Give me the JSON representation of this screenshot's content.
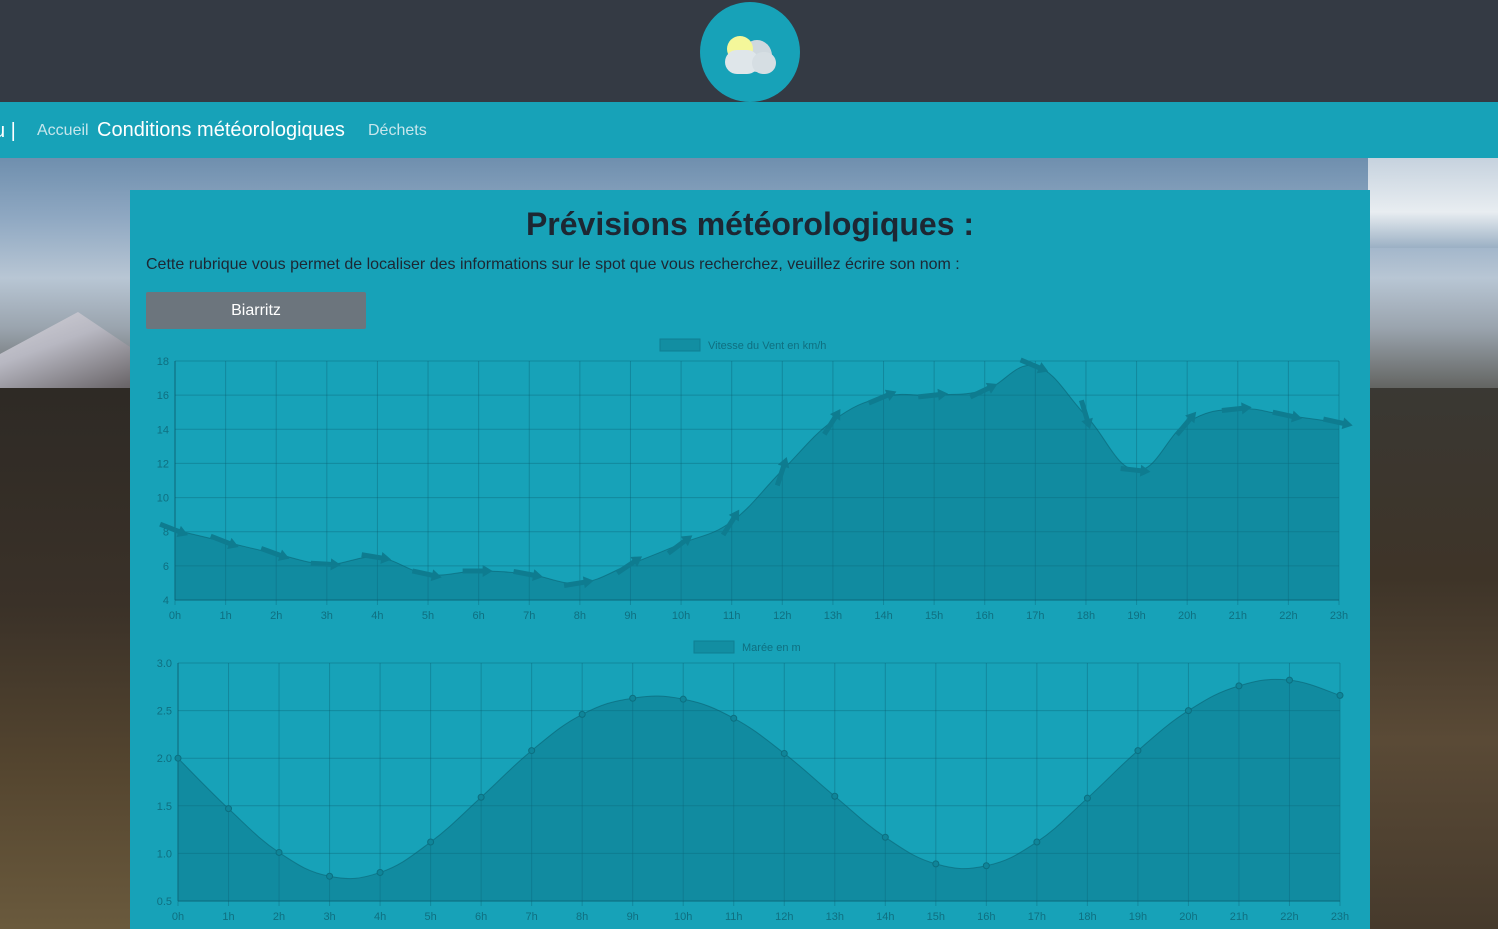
{
  "header": {
    "logo_icon": "sun-cloud-icon"
  },
  "nav": {
    "brand": "u |",
    "items": [
      {
        "label": "Accueil",
        "active": false
      },
      {
        "label": "Conditions météorologiques",
        "active": true
      },
      {
        "label": "Déchets",
        "active": false
      }
    ]
  },
  "main": {
    "title": "Prévisions météorologiques :",
    "description": "Cette rubrique vous permet de localiser des informations sur le spot que vous recherchez, veuillez écrire son nom :",
    "spot_button": "Biarritz"
  },
  "colors": {
    "accent": "#17a2b8",
    "header_bg": "#343a44",
    "button_bg": "#6c757d"
  },
  "chart_data": [
    {
      "type": "area",
      "legend": "Vitesse du Vent en km/h",
      "legend_position": "top",
      "x": [
        "0h",
        "1h",
        "2h",
        "3h",
        "4h",
        "5h",
        "6h",
        "7h",
        "8h",
        "9h",
        "10h",
        "11h",
        "12h",
        "13h",
        "14h",
        "15h",
        "16h",
        "17h",
        "18h",
        "19h",
        "20h",
        "21h",
        "22h",
        "23h"
      ],
      "values": [
        8.1,
        7.4,
        6.7,
        6.1,
        6.5,
        5.5,
        5.7,
        5.5,
        5.0,
        6.1,
        7.3,
        8.6,
        11.6,
        14.5,
        15.9,
        16.0,
        16.3,
        17.7,
        14.8,
        11.6,
        14.4,
        15.2,
        14.8,
        14.4
      ],
      "yticks": [
        4,
        6,
        8,
        10,
        12,
        14,
        16,
        18
      ],
      "ylim": [
        4,
        18
      ],
      "grid": true,
      "point_style": "arrow"
    },
    {
      "type": "area",
      "legend": "Marée en m",
      "legend_position": "top",
      "x": [
        "0h",
        "1h",
        "2h",
        "3h",
        "4h",
        "5h",
        "6h",
        "7h",
        "8h",
        "9h",
        "10h",
        "11h",
        "12h",
        "13h",
        "14h",
        "15h",
        "16h",
        "17h",
        "18h",
        "19h",
        "20h",
        "21h",
        "22h",
        "23h"
      ],
      "values": [
        2.0,
        1.47,
        1.01,
        0.76,
        0.8,
        1.12,
        1.59,
        2.08,
        2.46,
        2.63,
        2.62,
        2.42,
        2.05,
        1.6,
        1.17,
        0.89,
        0.87,
        1.12,
        1.58,
        2.08,
        2.5,
        2.76,
        2.82,
        2.66
      ],
      "yticks": [
        0.5,
        1.0,
        1.5,
        2.0,
        2.5,
        3.0
      ],
      "ylim": [
        0.5,
        3.0
      ],
      "grid": true,
      "point_style": "circle"
    }
  ]
}
